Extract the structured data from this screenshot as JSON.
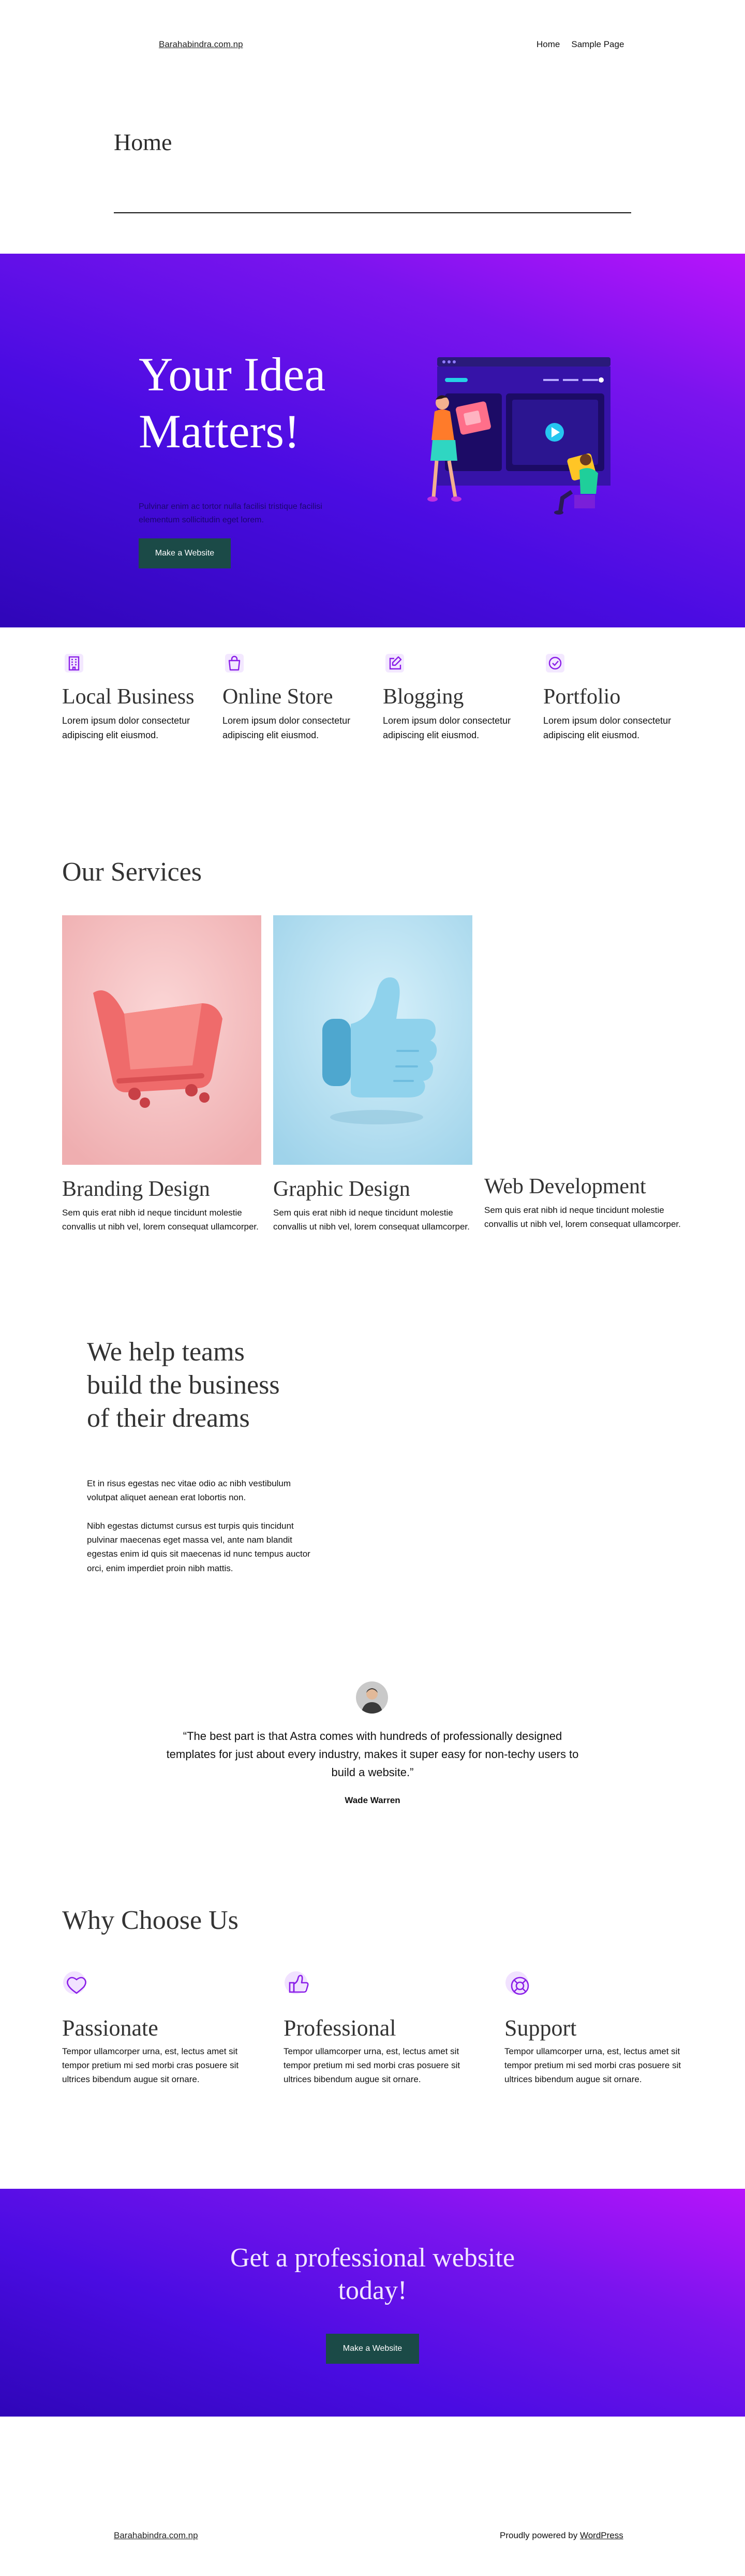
{
  "header": {
    "site_title": "Barahabindra.com.np",
    "nav": [
      "Home",
      "Sample Page"
    ]
  },
  "page_title": "Home",
  "hero": {
    "title": "Your Idea Matters!",
    "text": "Pulvinar enim ac tortor nulla facilisi tristique facilisi elementum sollicitudin eget lorem.",
    "button": "Make a Website"
  },
  "features": [
    {
      "icon": "building-icon",
      "title": "Local Business",
      "text": "Lorem ipsum dolor consectetur adipiscing elit eiusmod."
    },
    {
      "icon": "shopping-bag-icon",
      "title": "Online Store",
      "text": "Lorem ipsum dolor consectetur adipiscing elit eiusmod."
    },
    {
      "icon": "edit-icon",
      "title": "Blogging",
      "text": "Lorem ipsum dolor consectetur adipiscing elit eiusmod."
    },
    {
      "icon": "check-circle-icon",
      "title": "Portfolio",
      "text": "Lorem ipsum dolor consectetur adipiscing elit eiusmod."
    }
  ],
  "services": {
    "title": "Our Services",
    "items": [
      {
        "image": "shopping-cart-3d-image",
        "title": "Branding Design",
        "text": "Sem quis erat nibh id neque tincidunt molestie convallis ut nibh vel, lorem consequat ullamcorper."
      },
      {
        "image": "thumbs-up-3d-image",
        "title": "Graphic Design",
        "text": "Sem quis erat nibh id neque tincidunt molestie convallis ut nibh vel, lorem consequat ullamcorper."
      },
      {
        "image": "",
        "title": "Web Development",
        "text": "Sem quis erat nibh id neque tincidunt molestie convallis ut nibh vel, lorem consequat ullamcorper."
      }
    ]
  },
  "help": {
    "title": "We help teams build the business of their dreams",
    "paragraphs": [
      "Et in risus egestas nec vitae odio ac nibh vestibulum volutpat aliquet aenean erat lobortis non.",
      "Nibh egestas dictumst cursus est turpis quis tincidunt pulvinar maecenas eget massa vel, ante nam blandit egestas enim id quis sit maecenas id nunc tempus auctor orci, enim imperdiet proin nibh mattis."
    ]
  },
  "testimonial": {
    "quote": "“The best part is that Astra comes with hundreds of professionally designed templates for just about every industry, makes it super easy for non-techy users to build a website.”",
    "author": "Wade Warren"
  },
  "why": {
    "title": "Why Choose Us",
    "items": [
      {
        "icon": "heart-icon",
        "title": "Passionate",
        "text": "Tempor ullamcorper urna, est, lectus amet sit tempor pretium mi sed morbi cras posuere sit ultrices bibendum augue sit ornare."
      },
      {
        "icon": "thumbs-up-icon",
        "title": "Professional",
        "text": "Tempor ullamcorper urna, est, lectus amet sit tempor pretium mi sed morbi cras posuere sit ultrices bibendum augue sit ornare."
      },
      {
        "icon": "lifebuoy-icon",
        "title": "Support",
        "text": "Tempor ullamcorper urna, est, lectus amet sit tempor pretium mi sed morbi cras posuere sit ultrices bibendum augue sit ornare."
      }
    ]
  },
  "cta": {
    "title": "Get a professional website today!",
    "button": "Make a Website"
  },
  "footer": {
    "site_title": "Barahabindra.com.np",
    "credit_prefix": "Proudly powered by ",
    "credit_link": "WordPress"
  },
  "colors": {
    "accent": "#7a14ee",
    "gradient_start": "#b814fb",
    "gradient_end": "#2f06b8",
    "button": "#1b4a47"
  }
}
